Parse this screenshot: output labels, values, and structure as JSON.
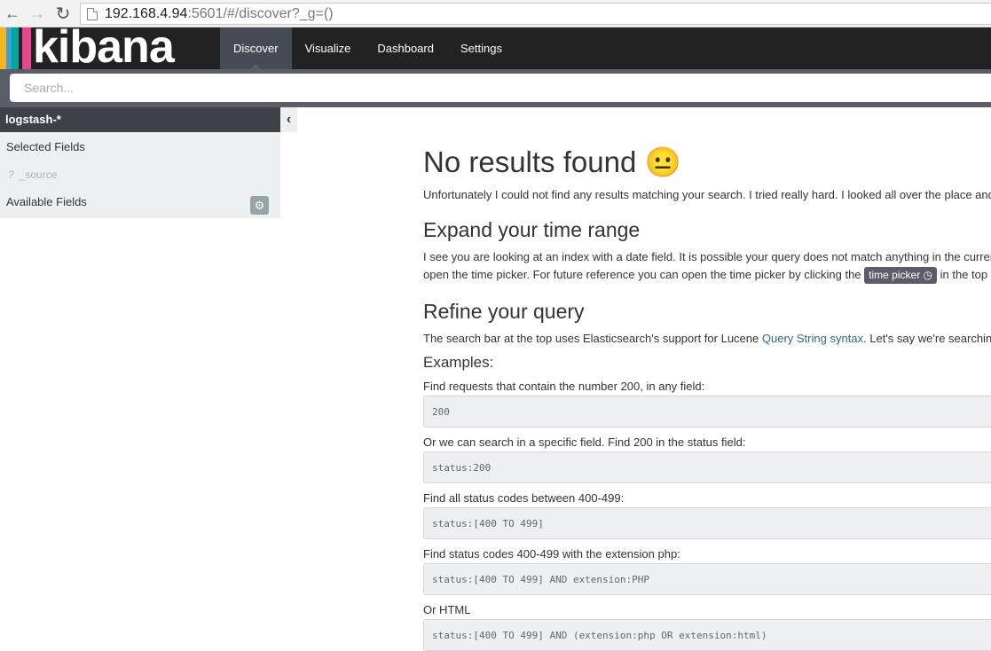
{
  "browser": {
    "url_host": "192.168.4.94",
    "url_rest": ":5601/#/discover?_g=()"
  },
  "navbar": {
    "logo_text": "kibana",
    "logo_colors": [
      "#e8478b",
      "#3f9fd3",
      "#00a69b",
      "#f6b61e",
      "#ffffff"
    ],
    "tabs": [
      "Discover",
      "Visualize",
      "Dashboard",
      "Settings"
    ],
    "active_tab": "Discover"
  },
  "search": {
    "placeholder": "Search..."
  },
  "sidebar": {
    "index_pattern": "logstash-*",
    "selected_fields_label": "Selected Fields",
    "source_field_type": "?",
    "source_field": "_source",
    "available_fields_label": "Available Fields"
  },
  "main": {
    "title": "No results found",
    "title_emoji": "😐",
    "intro": "Unfortunately I could not find any results matching your search. I tried really hard. I looked all over the place and frankly, I just couldn't find anything good. Help me, help you.",
    "time_heading": "Expand your time range",
    "time_line1": "I see you are looking at an index with a date field. It is possible your query does not match anything in the current time range, or that there is no data at all in the currently selected time range. Try selecting a wider time range by opening the time picker.",
    "time_line2_pre": "open the time picker. For future reference you can open the time picker by clicking the",
    "time_picker_label": "time picker",
    "time_line2_post": "in the top right corner of your screen.",
    "refine_heading": "Refine your query",
    "refine_pre": "The search bar at the top uses Elasticsearch's support for Lucene",
    "refine_link": "Query String syntax",
    "refine_post": ". Let's say we're searching web server logs that have been parsed into a few fields.",
    "examples_label": "Examples:",
    "examples": [
      {
        "desc": "Find requests that contain the number 200, in any field:",
        "query": "200"
      },
      {
        "desc": "Or we can search in a specific field. Find 200 in the status field:",
        "query": "status:200"
      },
      {
        "desc": "Find all status codes between 400-499:",
        "query": "status:[400 TO 499]"
      },
      {
        "desc": "Find status codes 400-499 with the extension php:",
        "query": "status:[400 TO 499] AND extension:PHP"
      },
      {
        "desc": "Or HTML",
        "query": "status:[400 TO 499] AND (extension:php OR extension:html)"
      }
    ]
  }
}
